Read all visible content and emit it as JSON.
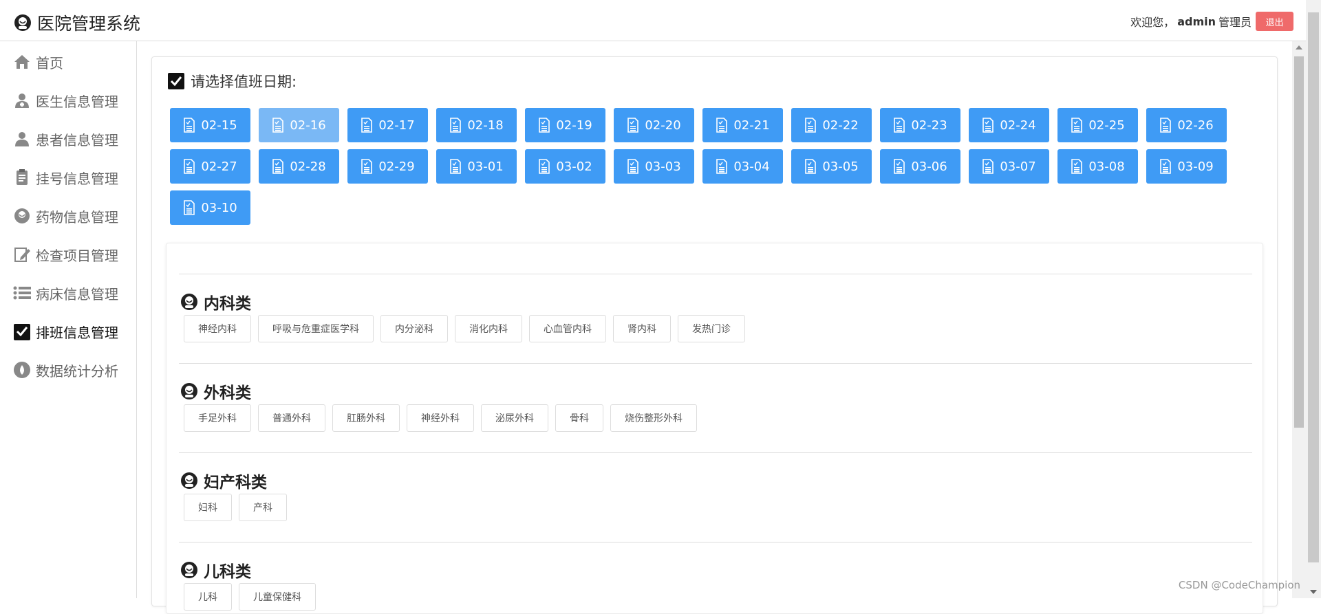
{
  "header": {
    "title": "医院管理系统",
    "welcome": "欢迎您，",
    "username": "admin",
    "role": "管理员",
    "logout_label": "退出",
    "logout_color": "#ef6a6a"
  },
  "sidebar": {
    "items": [
      {
        "label": "首页",
        "icon": "home-icon"
      },
      {
        "label": "医生信息管理",
        "icon": "doctor-icon"
      },
      {
        "label": "患者信息管理",
        "icon": "patient-icon"
      },
      {
        "label": "挂号信息管理",
        "icon": "clipboard-icon"
      },
      {
        "label": "药物信息管理",
        "icon": "medicine-icon"
      },
      {
        "label": "检查项目管理",
        "icon": "edit-icon"
      },
      {
        "label": "病床信息管理",
        "icon": "list-icon"
      },
      {
        "label": "排班信息管理",
        "icon": "checkbox-icon"
      },
      {
        "label": "数据统计分析",
        "icon": "drop-icon"
      }
    ],
    "active": "排班信息管理"
  },
  "schedule": {
    "title": "请选择值班日期:",
    "selected": "02-16",
    "accent": "#3f9bf5",
    "dates": [
      "02-15",
      "02-16",
      "02-17",
      "02-18",
      "02-19",
      "02-20",
      "02-21",
      "02-22",
      "02-23",
      "02-24",
      "02-25",
      "02-26",
      "02-27",
      "02-28",
      "02-29",
      "03-01",
      "03-02",
      "03-03",
      "03-04",
      "03-05",
      "03-06",
      "03-07",
      "03-08",
      "03-09",
      "03-10"
    ]
  },
  "departments": [
    {
      "name": "内科类",
      "items": [
        "神经内科",
        "呼吸与危重症医学科",
        "内分泌科",
        "消化内科",
        "心血管内科",
        "肾内科",
        "发热门诊"
      ]
    },
    {
      "name": "外科类",
      "items": [
        "手足外科",
        "普通外科",
        "肛肠外科",
        "神经外科",
        "泌尿外科",
        "骨科",
        "烧伤整形外科"
      ]
    },
    {
      "name": "妇产科类",
      "items": [
        "妇科",
        "产科"
      ]
    },
    {
      "name": "儿科类",
      "items": [
        "儿科",
        "儿童保健科"
      ]
    }
  ],
  "watermark": "CSDN @CodeChampion"
}
